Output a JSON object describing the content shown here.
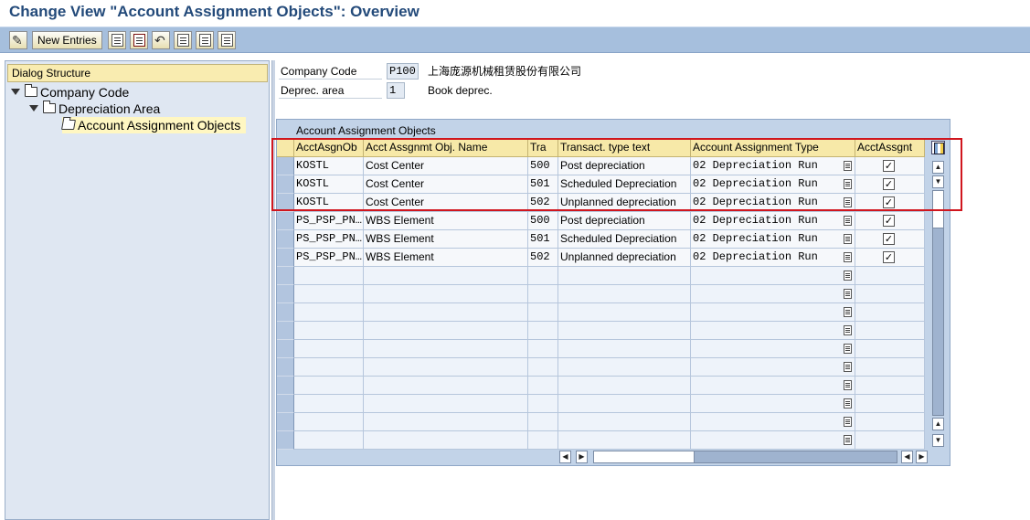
{
  "window": {
    "title": "Change View \"Account Assignment Objects\": Overview"
  },
  "toolbar": {
    "buttons": [
      {
        "icon": "display-change-icon"
      },
      {
        "label": "New Entries"
      },
      {
        "icon": "copy-as-icon"
      },
      {
        "icon": "delete-icon"
      },
      {
        "icon": "undo-change-icon"
      },
      {
        "icon": "select-all-icon"
      },
      {
        "icon": "select-block-icon"
      },
      {
        "icon": "deselect-all-icon"
      }
    ]
  },
  "dialog_structure": {
    "header": "Dialog Structure",
    "items": [
      {
        "label": "Company Code",
        "level": 0,
        "expanded": true
      },
      {
        "label": "Depreciation Area",
        "level": 1,
        "expanded": true
      },
      {
        "label": "Account Assignment Objects",
        "level": 2,
        "selected": true
      }
    ]
  },
  "fields": {
    "company_code": {
      "label": "Company Code",
      "value": "P100",
      "description": "上海庞源机械租赁股份有限公司"
    },
    "deprec_area": {
      "label": "Deprec. area",
      "value": "1",
      "description": "Book deprec."
    }
  },
  "table": {
    "title": "Account Assignment Objects",
    "columns": [
      "AcctAsgnOb",
      "Acct Assgnmt Obj. Name",
      "Tra",
      "Transact. type text",
      "Account Assignment Type",
      "AcctAssgnt"
    ],
    "rows": [
      {
        "obj": "KOSTL",
        "name": "Cost Center",
        "tra": "500",
        "text": "Post depreciation",
        "type": "02 Depreciation Run",
        "checked": "✓"
      },
      {
        "obj": "KOSTL",
        "name": "Cost Center",
        "tra": "501",
        "text": "Scheduled Depreciation",
        "type": "02 Depreciation Run",
        "checked": "✓"
      },
      {
        "obj": "KOSTL",
        "name": "Cost Center",
        "tra": "502",
        "text": "Unplanned depreciation",
        "type": "02 Depreciation Run",
        "checked": "✓"
      },
      {
        "obj": "PS_PSP_PN…",
        "name": "WBS Element",
        "tra": "500",
        "text": "Post depreciation",
        "type": "02 Depreciation Run",
        "checked": "✓"
      },
      {
        "obj": "PS_PSP_PN…",
        "name": "WBS Element",
        "tra": "501",
        "text": "Scheduled Depreciation",
        "type": "02 Depreciation Run",
        "checked": "✓"
      },
      {
        "obj": "PS_PSP_PN…",
        "name": "WBS Element",
        "tra": "502",
        "text": "Unplanned depreciation",
        "type": "02 Depreciation Run",
        "checked": "✓"
      }
    ],
    "empty_rows": 10
  },
  "colors": {
    "title_text": "#234a7a",
    "toolbar_bg": "#a6bfdd",
    "header_bg": "#f7e9a8",
    "highlight_box": "#d0161e"
  }
}
